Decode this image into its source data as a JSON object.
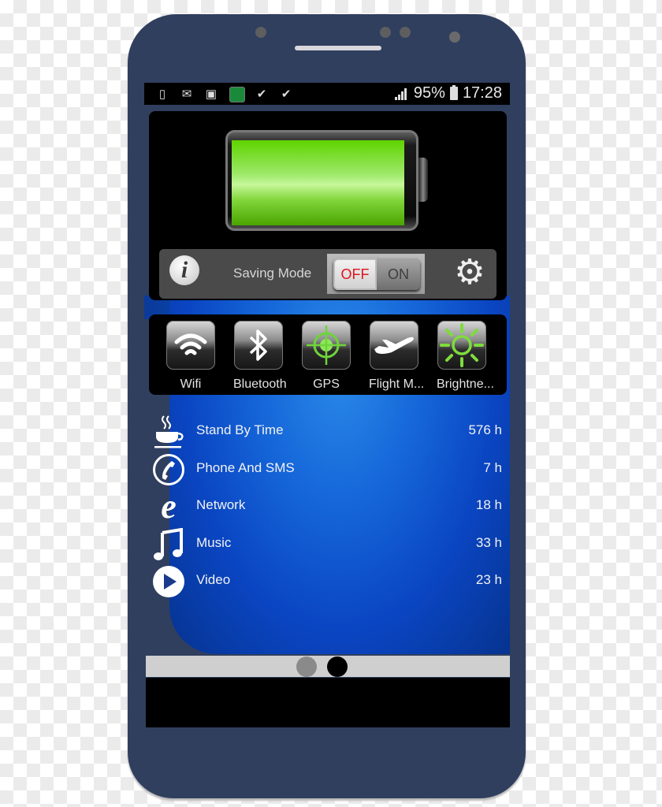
{
  "status_bar": {
    "left_icons": [
      "tablet-check-icon",
      "mail-icon",
      "image-icon",
      "app-globe-icon",
      "file-check-icon",
      "briefcase-check-icon"
    ],
    "signal_icon": "signal-icon",
    "battery_percent": "95%",
    "battery_icon": "battery-icon",
    "time": "17:28"
  },
  "battery_widget": {
    "level_percent": 95,
    "fill_color": "#6ed41a"
  },
  "saving_mode": {
    "info_icon": "info-icon",
    "label": "Saving Mode",
    "toggle_off_label": "OFF",
    "toggle_on_label": "ON",
    "state": "OFF",
    "settings_icon": "gear-icon"
  },
  "quick_toggles": [
    {
      "label": "Wifi",
      "icon": "wifi-icon"
    },
    {
      "label": "Bluetooth",
      "icon": "bluetooth-icon"
    },
    {
      "label": "GPS",
      "icon": "gps-icon"
    },
    {
      "label": "Flight M...",
      "icon": "airplane-icon"
    },
    {
      "label": "Brightne...",
      "icon": "brightness-icon"
    }
  ],
  "usage_list": [
    {
      "name": "Stand By Time",
      "value": "576 h",
      "icon": "coffee-cup-icon"
    },
    {
      "name": "Phone And SMS",
      "value": "7 h",
      "icon": "phone-icon"
    },
    {
      "name": "Network",
      "value": "18 h",
      "icon": "internet-explorer-icon"
    },
    {
      "name": "Music",
      "value": "33 h",
      "icon": "music-note-icon"
    },
    {
      "name": "Video",
      "value": "23 h",
      "icon": "play-icon"
    }
  ],
  "pager": {
    "page_count": 2,
    "active_page": 2
  }
}
